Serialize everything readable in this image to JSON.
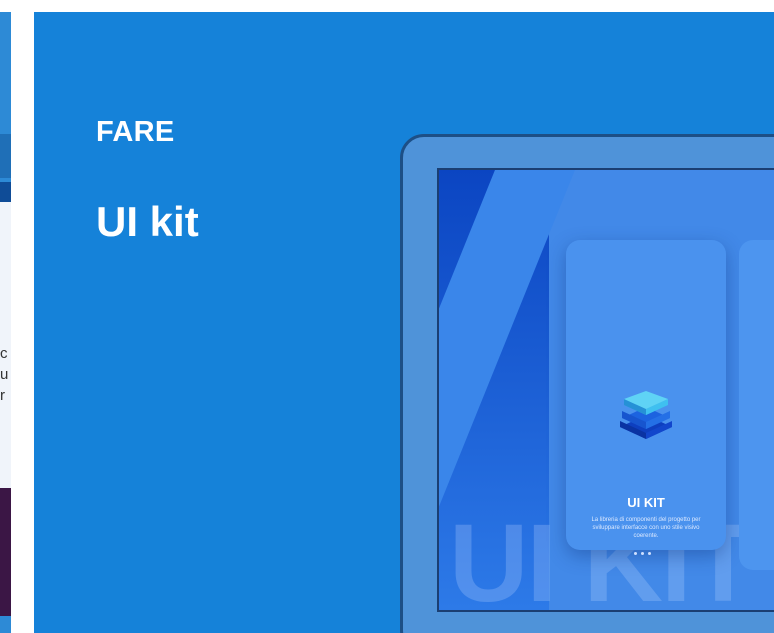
{
  "prev_card": {
    "text_fragments": [
      "c",
      "u",
      "r"
    ]
  },
  "card": {
    "kicker": "FARE",
    "title": "UI kit"
  },
  "mockup": {
    "card_heading": "UI KIT",
    "card_desc": "La libreria di componenti del progetto per sviluppare interfacce con uno stile visivo coerente.",
    "watermark": "UI KIT"
  },
  "colors": {
    "card_bg": "#1582d9",
    "laptop_frame": "#4f93d9",
    "accent_dark": "#0b3fd1"
  }
}
